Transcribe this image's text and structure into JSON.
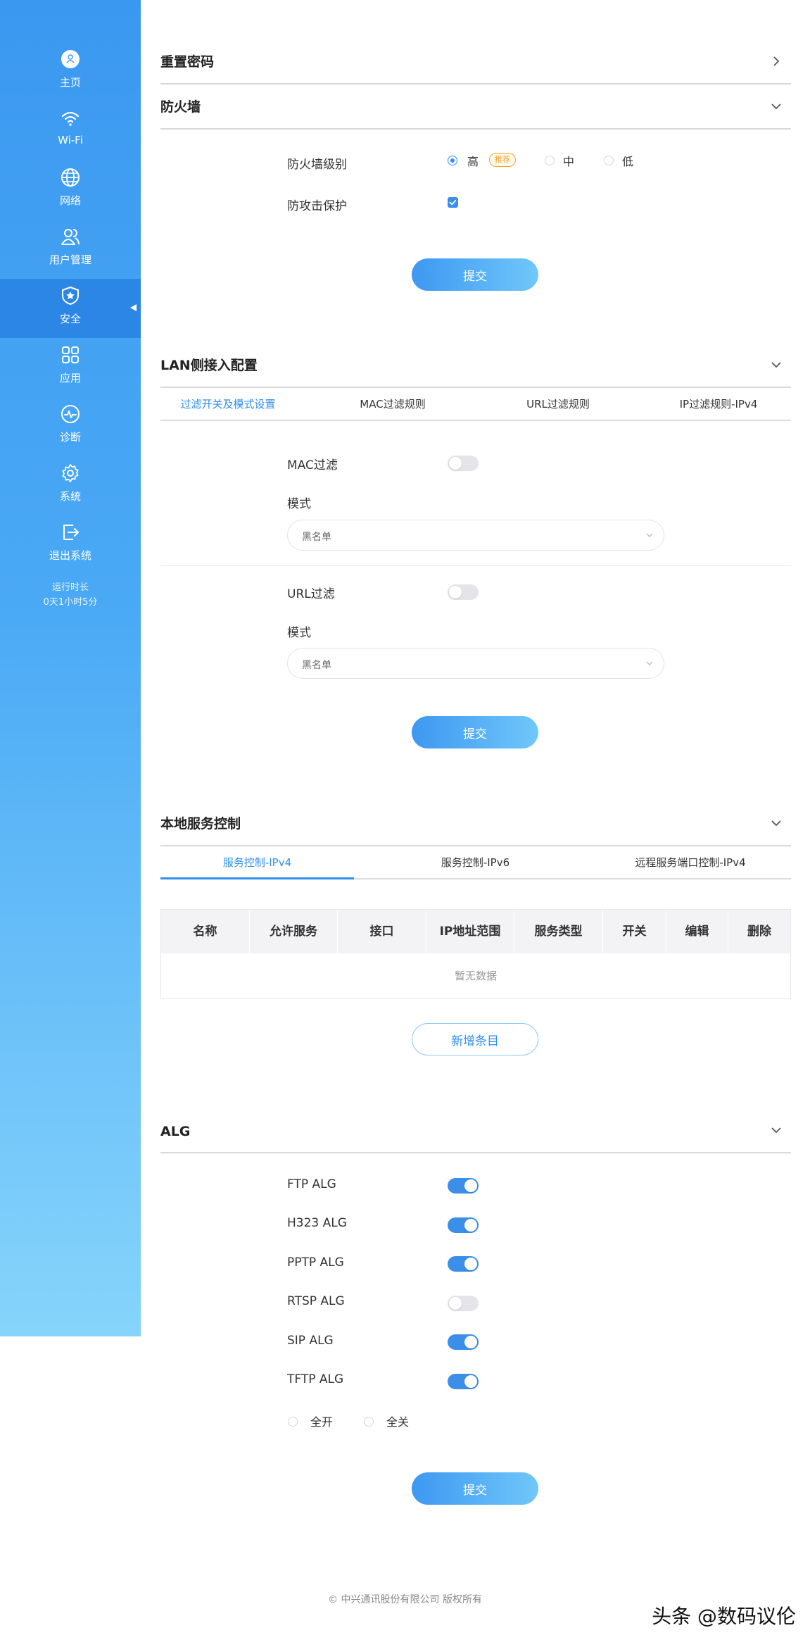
{
  "sidebar": {
    "items": [
      {
        "label": "主页",
        "icon": "user-icon"
      },
      {
        "label": "Wi-Fi",
        "icon": "wifi-icon"
      },
      {
        "label": "网络",
        "icon": "globe-icon"
      },
      {
        "label": "用户管理",
        "icon": "users-icon"
      },
      {
        "label": "安全",
        "icon": "shield-star-icon",
        "active": true
      },
      {
        "label": "应用",
        "icon": "apps-grid-icon"
      },
      {
        "label": "诊断",
        "icon": "pulse-icon"
      },
      {
        "label": "系统",
        "icon": "gear-icon"
      },
      {
        "label": "退出系统",
        "icon": "logout-icon"
      }
    ],
    "runtime_label": "运行时长",
    "runtime_value": "0天1小时5分"
  },
  "reset_password": {
    "title": "重置密码"
  },
  "firewall": {
    "title": "防火墙",
    "level_label": "防火墙级别",
    "level_options": [
      "高",
      "中",
      "低"
    ],
    "level_selected": "高",
    "recommend_badge": "推荐",
    "attack_label": "防攻击保护",
    "attack_checked": true,
    "submit": "提交"
  },
  "lan": {
    "title": "LAN侧接入配置",
    "tabs": [
      "过滤开关及模式设置",
      "MAC过滤规则",
      "URL过滤规则",
      "IP过滤规则-IPv4"
    ],
    "active_tab": 0,
    "mac_filter_label": "MAC过滤",
    "mac_filter_on": false,
    "mac_mode_label": "模式",
    "mac_mode_value": "黑名单",
    "url_filter_label": "URL过滤",
    "url_filter_on": false,
    "url_mode_label": "模式",
    "url_mode_value": "黑名单",
    "submit": "提交"
  },
  "local_service": {
    "title": "本地服务控制",
    "tabs": [
      "服务控制-IPv4",
      "服务控制-IPv6",
      "远程服务端口控制-IPv4"
    ],
    "active_tab": 0,
    "columns": [
      "名称",
      "允许服务",
      "接口",
      "IP地址范围",
      "服务类型",
      "开关",
      "编辑",
      "删除"
    ],
    "empty_text": "暂无数据",
    "add_button": "新增条目"
  },
  "alg": {
    "title": "ALG",
    "items": [
      {
        "label": "FTP ALG",
        "on": true
      },
      {
        "label": "H323 ALG",
        "on": true
      },
      {
        "label": "PPTP ALG",
        "on": true
      },
      {
        "label": "RTSP ALG",
        "on": false
      },
      {
        "label": "SIP ALG",
        "on": true
      },
      {
        "label": "TFTP ALG",
        "on": true
      }
    ],
    "all_on_label": "全开",
    "all_off_label": "全关",
    "submit": "提交"
  },
  "footer": {
    "copyright": "© 中兴通讯股份有限公司 版权所有"
  },
  "watermark": "头条 @数码议伦",
  "colors": {
    "accent": "#2f8ef0",
    "sidebar_top": "#3b98f0",
    "sidebar_bottom": "#86d4fb",
    "badge": "#f2a425"
  }
}
